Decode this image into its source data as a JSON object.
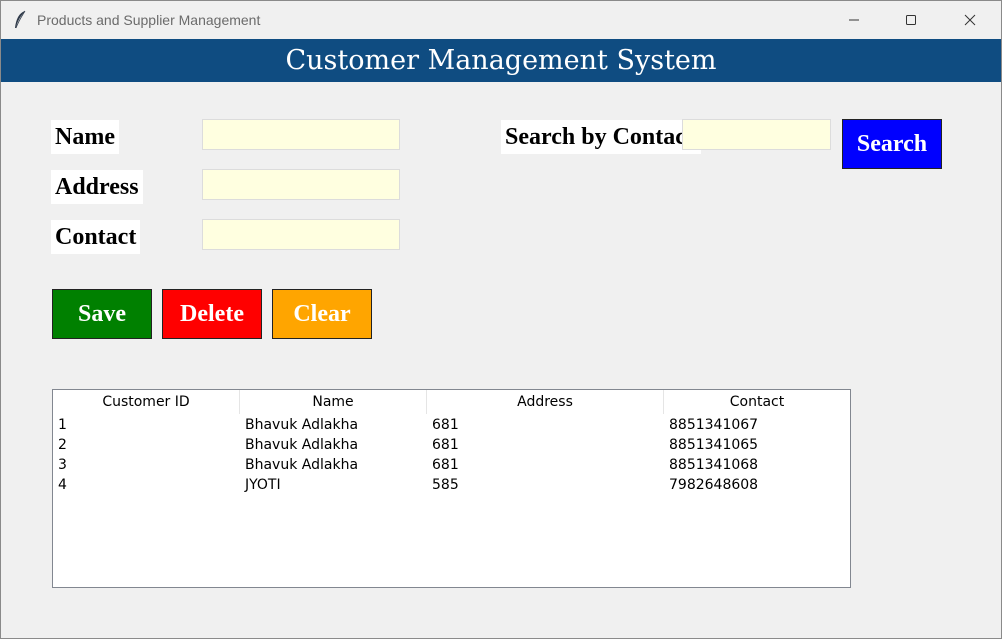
{
  "window": {
    "title": "Products and Supplier Management",
    "minimize_glyph": "—",
    "maximize_glyph": "☐",
    "close_glyph": "✕",
    "icon": "feather-icon"
  },
  "header": {
    "title": "Customer Management System",
    "background": "#0f4c81"
  },
  "form": {
    "name_label": "Name",
    "name_value": "",
    "address_label": "Address",
    "address_value": "",
    "contact_label": "Contact",
    "contact_value": "",
    "field_color": "#ffffe0"
  },
  "search": {
    "label": "Search by Contac",
    "value": "",
    "button_label": "Search",
    "button_color": "#0000ff"
  },
  "actions": {
    "save_label": "Save",
    "save_color": "#008000",
    "delete_label": "Delete",
    "delete_color": "#ff0000",
    "clear_label": "Clear",
    "clear_color": "#ffa500"
  },
  "table": {
    "columns": [
      "Customer ID",
      "Name",
      "Address",
      "Contact"
    ],
    "rows": [
      [
        "1",
        "Bhavuk Adlakha",
        "681",
        "8851341067"
      ],
      [
        "2",
        "Bhavuk Adlakha",
        "681",
        "8851341065"
      ],
      [
        "3",
        "Bhavuk Adlakha",
        "681",
        "8851341068"
      ],
      [
        "4",
        "JYOTI",
        "585",
        "7982648608"
      ]
    ]
  }
}
